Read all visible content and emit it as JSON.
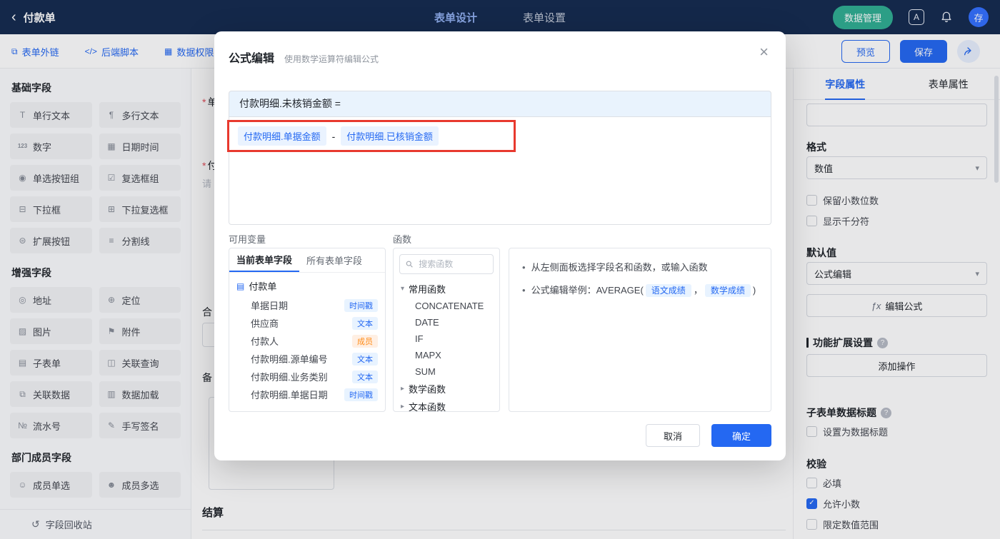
{
  "icons": {
    "back": "‹",
    "close": "×",
    "chevron_down": "▾",
    "chevron_right": "▸",
    "check": "✓",
    "fx": "ƒx",
    "bullet": "•",
    "recycle": "↺",
    "doc": "▤",
    "asterisk": "*",
    "help": "?"
  },
  "topbar": {
    "back_label": "付款单",
    "tabs": [
      {
        "label": "表单设计",
        "active": true
      },
      {
        "label": "表单设置",
        "active": false
      }
    ],
    "data_manage_label": "数据管理",
    "lang_glyph": "A",
    "avatar_label": "存"
  },
  "toolbar": {
    "links": [
      {
        "icon": "external-link-icon",
        "glyph": "⧉",
        "label": "表单外链"
      },
      {
        "icon": "script-icon",
        "glyph": "</>",
        "label": "后端脚本"
      },
      {
        "icon": "permission-icon",
        "glyph": "▦",
        "label": "数据权限"
      }
    ],
    "preview_label": "预览",
    "save_label": "保存"
  },
  "sidebar": {
    "sections": [
      {
        "title": "基础字段",
        "items": [
          {
            "id": "single-text",
            "icon": "single-text-icon",
            "glyph": "T",
            "label": "单行文本"
          },
          {
            "id": "multi-text",
            "icon": "multi-text-icon",
            "glyph": "¶",
            "label": "多行文本"
          },
          {
            "id": "number",
            "icon": "number-icon",
            "glyph": "123",
            "label": "数字"
          },
          {
            "id": "datetime",
            "icon": "calendar-icon",
            "glyph": "▦",
            "label": "日期时间"
          },
          {
            "id": "radio-group",
            "icon": "radio-icon",
            "glyph": "◉",
            "label": "单选按钮组"
          },
          {
            "id": "checkbox-group",
            "icon": "checkbox-icon",
            "glyph": "☑",
            "label": "复选框组"
          },
          {
            "id": "select",
            "icon": "select-icon",
            "glyph": "⊟",
            "label": "下拉框"
          },
          {
            "id": "multi-select",
            "icon": "multi-select-icon",
            "glyph": "⊞",
            "label": "下拉复选框"
          },
          {
            "id": "extend-button",
            "icon": "extend-button-icon",
            "glyph": "⊜",
            "label": "扩展按钮"
          },
          {
            "id": "divider",
            "icon": "divider-icon",
            "glyph": "≡",
            "label": "分割线"
          }
        ]
      },
      {
        "title": "增强字段",
        "items": [
          {
            "id": "address",
            "icon": "address-icon",
            "glyph": "◎",
            "label": "地址"
          },
          {
            "id": "location",
            "icon": "location-icon",
            "glyph": "⊕",
            "label": "定位"
          },
          {
            "id": "image",
            "icon": "image-icon",
            "glyph": "▨",
            "label": "图片"
          },
          {
            "id": "attachment",
            "icon": "attachment-icon",
            "glyph": "⚑",
            "label": "附件"
          },
          {
            "id": "subform",
            "icon": "subform-icon",
            "glyph": "▤",
            "label": "子表单"
          },
          {
            "id": "lookup",
            "icon": "lookup-query-icon",
            "glyph": "◫",
            "label": "关联查询"
          },
          {
            "id": "linked-data",
            "icon": "linked-data-icon",
            "glyph": "⧉",
            "label": "关联数据"
          },
          {
            "id": "data-load",
            "icon": "chart-icon",
            "glyph": "▥",
            "label": "数据加载"
          },
          {
            "id": "serial",
            "icon": "serial-number-icon",
            "glyph": "№",
            "label": "流水号"
          },
          {
            "id": "signature",
            "icon": "signature-icon",
            "glyph": "✎",
            "label": "手写签名"
          }
        ]
      },
      {
        "title": "部门成员字段",
        "items": [
          {
            "id": "member-single",
            "icon": "member-icon",
            "glyph": "☺",
            "label": "成员单选"
          },
          {
            "id": "member-multi",
            "icon": "members-icon",
            "glyph": "☻",
            "label": "成员多选"
          }
        ]
      }
    ],
    "recycle_label": "字段回收站"
  },
  "canvas": {
    "fragments": [
      {
        "text": "单",
        "required": true
      },
      {
        "text": "付",
        "required": true
      },
      {
        "text": "请",
        "required": false
      },
      {
        "text": "合",
        "required": false
      },
      {
        "text": "备",
        "required": false
      }
    ],
    "section_title": "结算"
  },
  "modal": {
    "title": "公式编辑",
    "subtitle": "使用数学运算符编辑公式",
    "target": "付款明细.未核销金额 =",
    "expression": [
      {
        "type": "field",
        "text": "付款明细.单据金额"
      },
      {
        "type": "op",
        "text": "-"
      },
      {
        "type": "field",
        "text": "付款明细.已核销金额"
      }
    ],
    "vars_label": "可用变量",
    "vars_tabs": [
      "当前表单字段",
      "所有表单字段"
    ],
    "tree_root": "付款单",
    "fields": [
      {
        "name": "单据日期",
        "tag": "时间戳",
        "tag_color": "blue"
      },
      {
        "name": "供应商",
        "tag": "文本",
        "tag_color": "blue"
      },
      {
        "name": "付款人",
        "tag": "成员",
        "tag_color": "orange"
      },
      {
        "name": "付款明细.源单编号",
        "tag": "文本",
        "tag_color": "blue"
      },
      {
        "name": "付款明细.业务类别",
        "tag": "文本",
        "tag_color": "blue"
      },
      {
        "name": "付款明细.单据日期",
        "tag": "时间戳",
        "tag_color": "blue"
      }
    ],
    "fn_label": "函数",
    "fn_search_placeholder": "搜索函数",
    "fn_groups": [
      {
        "name": "常用函数",
        "expanded": true,
        "items": [
          "CONCATENATE",
          "DATE",
          "IF",
          "MAPX",
          "SUM"
        ]
      },
      {
        "name": "数学函数",
        "expanded": false,
        "items": []
      },
      {
        "name": "文本函数",
        "expanded": false,
        "items": []
      }
    ],
    "help_line1": "从左侧面板选择字段名和函数，或输入函数",
    "help_example_prefix": "公式编辑举例：AVERAGE(",
    "help_chip1": "语文成绩",
    "help_sep": "，",
    "help_chip2": "数学成绩",
    "help_suffix": ")",
    "cancel_label": "取消",
    "confirm_label": "确定"
  },
  "props": {
    "tabs": [
      {
        "label": "字段属性",
        "active": true
      },
      {
        "label": "表单属性",
        "active": false
      }
    ],
    "name_value": "",
    "format_label": "格式",
    "format_value": "数值",
    "format_checks": [
      {
        "label": "保留小数位数",
        "checked": false
      },
      {
        "label": "显示千分符",
        "checked": false
      }
    ],
    "default_label": "默认值",
    "default_value": "公式编辑",
    "edit_formula_label": "编辑公式",
    "ext_header": "功能扩展设置",
    "add_action_label": "添加操作",
    "subform_header": "子表单数据标题",
    "subform_check": {
      "label": "设置为数据标题",
      "checked": false
    },
    "validate_header": "校验",
    "validate_checks": [
      {
        "label": "必填",
        "checked": false
      },
      {
        "label": "允许小数",
        "checked": true
      },
      {
        "label": "限定数值范围",
        "checked": false
      }
    ]
  }
}
